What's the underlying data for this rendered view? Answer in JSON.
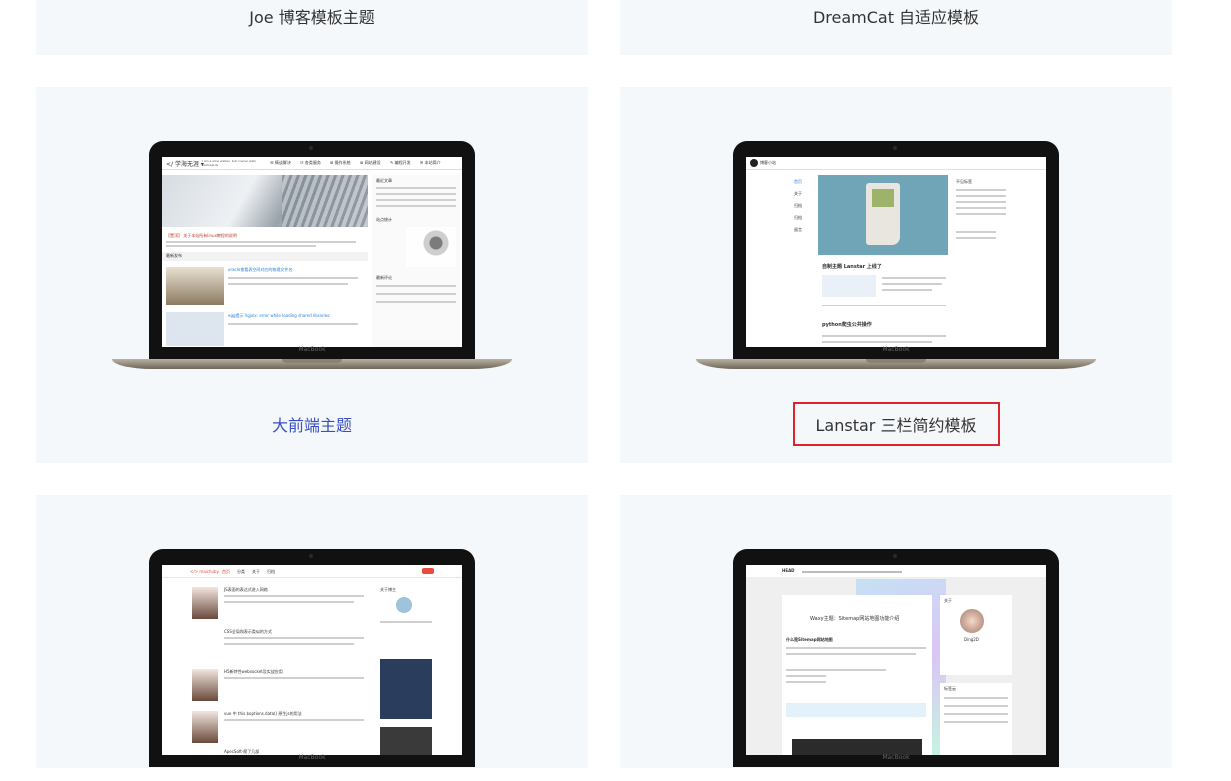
{
  "cards": [
    {
      "title": "Joe 博客模板主题"
    },
    {
      "title": "DreamCat 自适应模板"
    },
    {
      "title": "大前端主题"
    },
    {
      "title": "Lanstar 三栏简约模板"
    }
  ],
  "laptop_brand": "MacBook",
  "screens": {
    "dfe": {
      "logo": "</ 学海无涯 ▾",
      "tagline": "I am a slow walker, but I never walk backwards",
      "nav": [
        "☰ 情谈解决",
        "☷ 各类服务",
        "⊞ 操作系统",
        "⊞ 网站建设",
        "✎ 编程开发",
        "✉ 本站简介"
      ],
      "notice": "【置顶】 关于本站所有linux教程的说明",
      "section": "最新发布",
      "post1": "oracle查看表空间对应的物理文件名",
      "post2": "egg提示 /lgjxlx: error while loading shared libraries:",
      "side1": "最近文章",
      "side2": "站点统计",
      "side3": "最新评论"
    },
    "lanstar": {
      "site": "博客小站",
      "menu": [
        "首页",
        "关于",
        "归档",
        "归档",
        "留言"
      ],
      "post1": "自制主题 Lanstar 上线了",
      "post2": "python爬虫公共操作",
      "side": "不见标签"
    },
    "blog3": {
      "logo": "</> maichuby",
      "nav": [
        "首页",
        "分类",
        "关于",
        "归档"
      ],
      "side": "关于博主",
      "posts": [
        "JS表面的表达式进入网络",
        "CSS全局和表示类似的方式",
        "H5新特性websocket及实战应用",
        "vue 中 this.$options.data() 原生js的用法",
        "ApecSoft-爬了几部"
      ]
    },
    "waxy": {
      "logo": "HEAD",
      "title": "Waxy主题：Sitemap网站地图功能介绍",
      "heading": "什么是Sitemap网站地图",
      "side1": "关于",
      "side2": "标签云",
      "author": "Ding2D"
    }
  },
  "colors": {
    "selected_border": "#d9252b",
    "link": "#3a4fc4",
    "card_bg": "#f5f8fb"
  }
}
